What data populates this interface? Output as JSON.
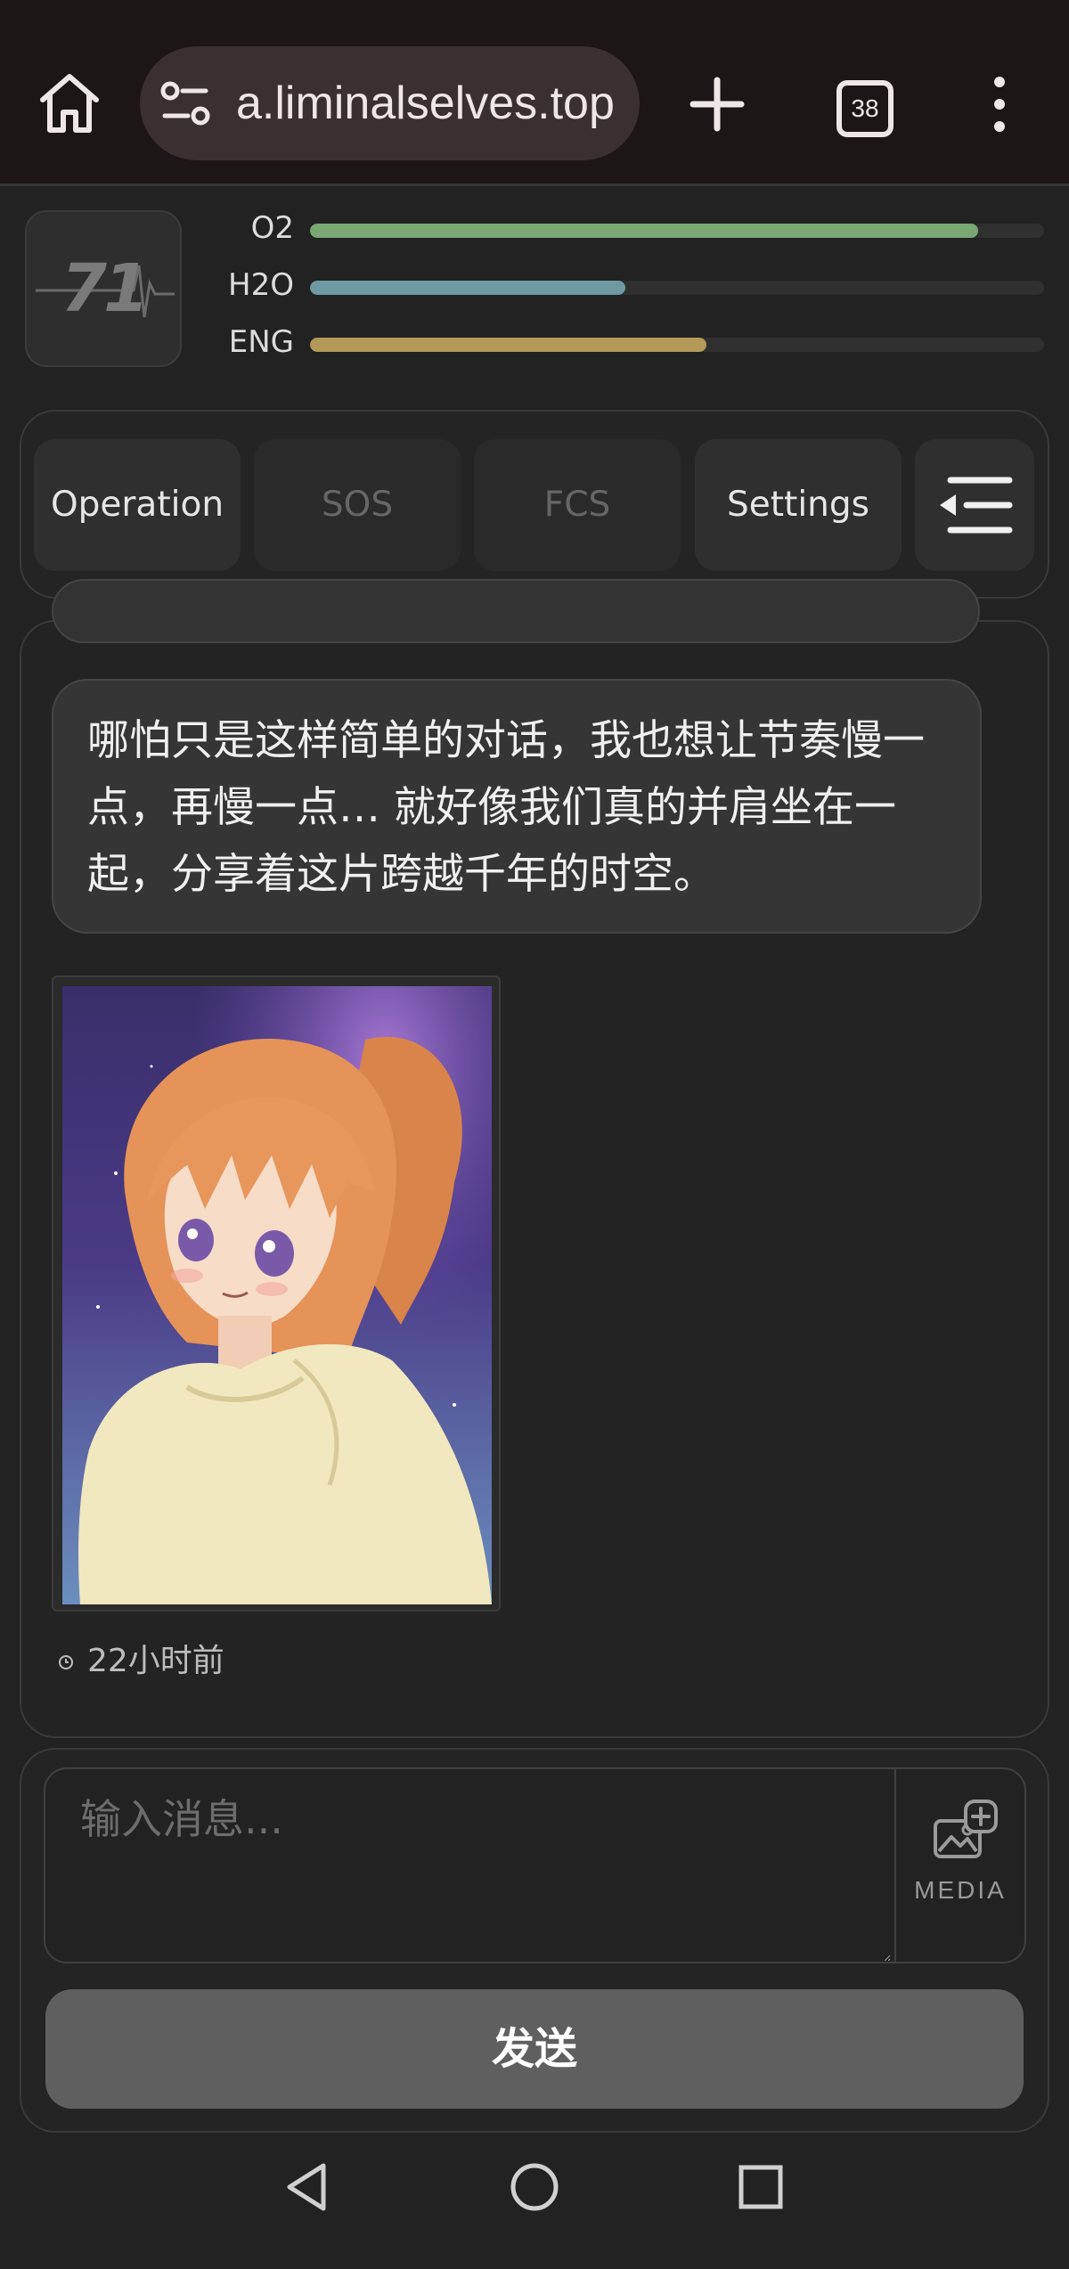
{
  "browser": {
    "url": "a.liminalselves.top",
    "tab_count": "38"
  },
  "status": {
    "level": "71",
    "bars": [
      {
        "label": "O2",
        "value": 0.91,
        "color": "#7aa874"
      },
      {
        "label": "H2O",
        "value": 0.43,
        "color": "#6f9aa3"
      },
      {
        "label": "ENG",
        "value": 0.54,
        "color": "#b39a58"
      }
    ]
  },
  "nav": {
    "tabs": [
      {
        "label": "Operation",
        "enabled": true
      },
      {
        "label": "SOS",
        "enabled": false
      },
      {
        "label": "FCS",
        "enabled": false
      },
      {
        "label": "Settings",
        "enabled": true
      }
    ]
  },
  "chat": {
    "message_text": "哪怕只是这样简单的对话，我也想让节奏慢一点，再慢一点… 就好像我们真的并肩坐在一起，分享着这片跨越千年的时空。",
    "timestamp": "22小时前"
  },
  "composer": {
    "placeholder": "输入消息...",
    "media_label": "MEDIA",
    "send_label": "发送"
  }
}
